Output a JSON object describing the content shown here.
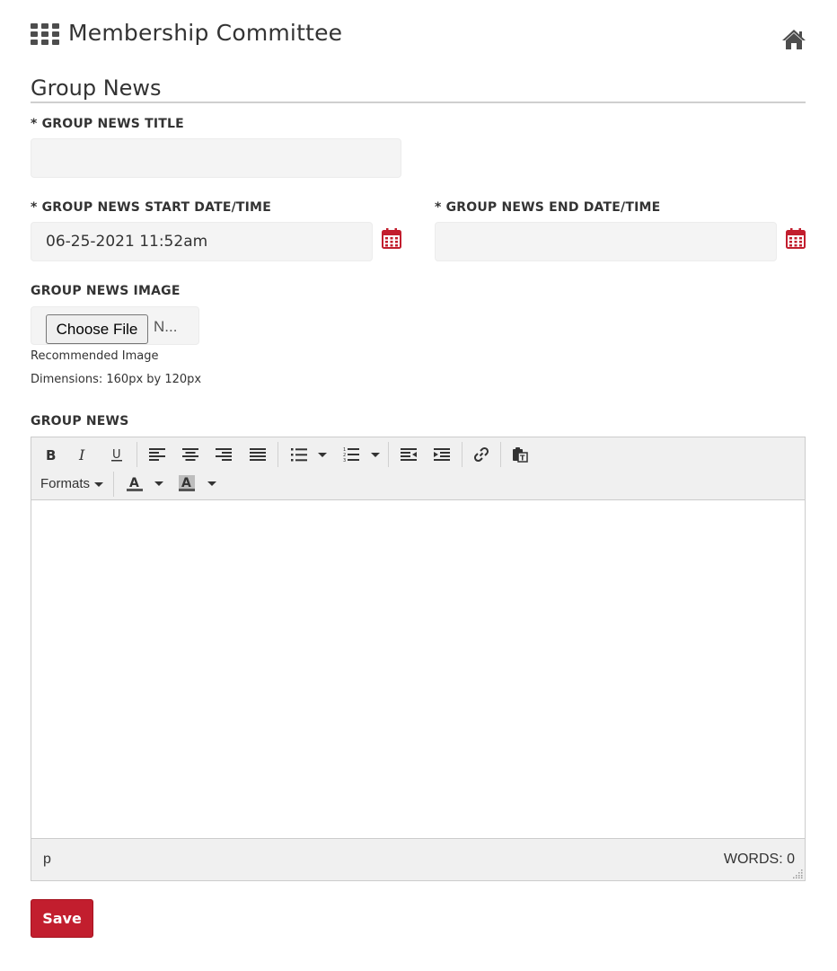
{
  "header": {
    "title": "Membership Committee"
  },
  "section": {
    "title": "Group News"
  },
  "form": {
    "title_label": "* GROUP NEWS TITLE",
    "title_value": "",
    "start_label": "* GROUP NEWS START DATE/TIME",
    "start_value": "06-25-2021 11:52am",
    "end_label": "* GROUP NEWS END DATE/TIME",
    "end_value": "",
    "image_label": "GROUP NEWS IMAGE",
    "choose_file": "Choose File",
    "file_status": "N...",
    "help_line1": "Recommended Image",
    "help_line2": "Dimensions: 160px by 120px",
    "news_label": "GROUP NEWS"
  },
  "editor": {
    "formats_label": "Formats",
    "path": "p",
    "word_count": "WORDS: 0"
  },
  "actions": {
    "save_label": "Save"
  },
  "colors": {
    "accent": "#c21e2e",
    "calendar": "#c21e2e",
    "field_bg": "#f4f4f4"
  }
}
